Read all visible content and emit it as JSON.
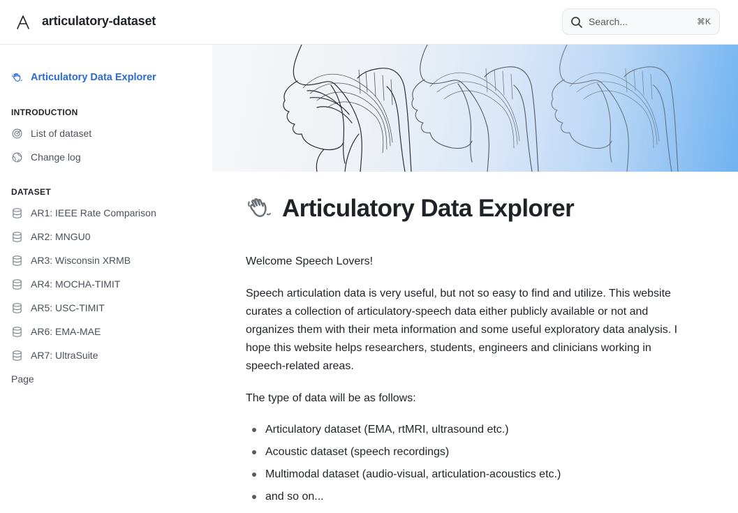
{
  "header": {
    "site_title": "articulatory-dataset",
    "search_placeholder": "Search...",
    "search_shortcut": "⌘K"
  },
  "sidebar": {
    "top_item": {
      "label": "Articulatory Data Explorer",
      "icon": "waving-hand-icon"
    },
    "sections": [
      {
        "title": "INTRODUCTION",
        "items": [
          {
            "label": "List of dataset",
            "icon": "target-icon"
          },
          {
            "label": "Change log",
            "icon": "globe-icon"
          }
        ]
      },
      {
        "title": "DATASET",
        "items": [
          {
            "label": "AR1: IEEE Rate Comparison",
            "icon": "database-icon"
          },
          {
            "label": "AR2: MNGU0",
            "icon": "database-icon"
          },
          {
            "label": "AR3: Wisconsin XRMB",
            "icon": "database-icon"
          },
          {
            "label": "AR4: MOCHA-TIMIT",
            "icon": "database-icon"
          },
          {
            "label": "AR5: USC-TIMIT",
            "icon": "database-icon"
          },
          {
            "label": "AR6: EMA-MAE",
            "icon": "database-icon"
          },
          {
            "label": "AR7: UltraSuite",
            "icon": "database-icon"
          }
        ]
      }
    ],
    "page_item": "Page"
  },
  "main": {
    "title": "Articulatory Data Explorer",
    "welcome": "Welcome Speech Lovers!",
    "intro": "Speech articulation data is very useful, but not so easy to find and utilize. This website curates a collection of articulatory-speech data either publicly available or not and organizes them with their meta information and some useful exploratory data analysis. I hope this website helps researchers, students, engineers and clinicians working in speech-related areas.",
    "types_lead": "The type of data will be as follows:",
    "types": [
      "Articulatory dataset (EMA, rtMRI, ultrasound etc.)",
      "Acoustic dataset (speech recordings)",
      "Multimodal dataset (audio-visual, articulation-acoustics etc.)",
      "and so on..."
    ]
  },
  "colors": {
    "accent": "#2b6bd6",
    "banner_end": "#6fb2f1"
  }
}
